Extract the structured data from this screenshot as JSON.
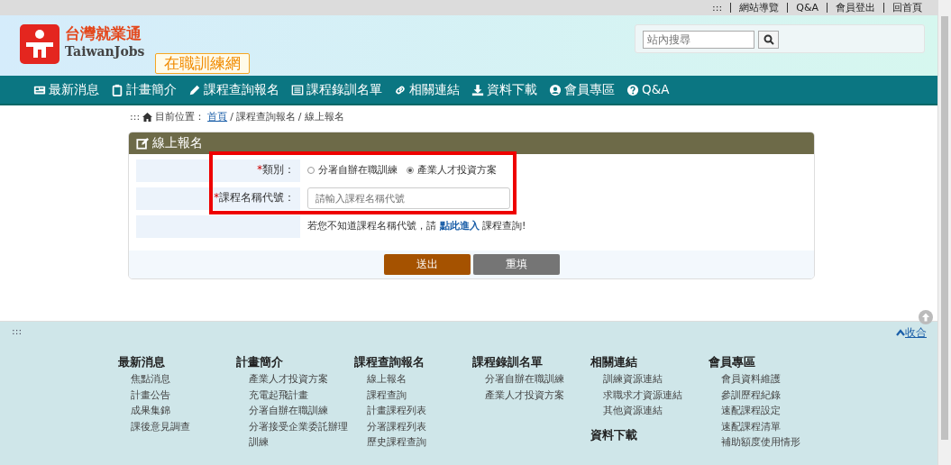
{
  "top_links": [
    ":::",
    "網站導覽",
    "Q&A",
    "會員登出",
    "回首頁"
  ],
  "logo": {
    "name": "台灣就業通",
    "subtitle": "TaiwanJobs"
  },
  "site_badge": "在職訓練網",
  "search": {
    "placeholder": "站內搜尋"
  },
  "nav": [
    {
      "label": "最新消息"
    },
    {
      "label": "計畫簡介"
    },
    {
      "label": "課程查詢報名"
    },
    {
      "label": "課程錄訓名單"
    },
    {
      "label": "相關連結"
    },
    {
      "label": "資料下載"
    },
    {
      "label": "會員專區"
    },
    {
      "label": "Q&A"
    }
  ],
  "breadcrumb": {
    "prefix": ":::",
    "label": "目前位置：",
    "separator": "/",
    "items": [
      {
        "text": "首頁",
        "link": true
      },
      {
        "text": "課程查詢報名",
        "link": false
      },
      {
        "text": "線上報名",
        "link": false
      }
    ]
  },
  "panel": {
    "title": "線上報名",
    "required_mark": "*",
    "category": {
      "label": "類別：",
      "options": [
        {
          "label": "分署自辦在職訓練",
          "selected": false
        },
        {
          "label": "產業人才投資方案",
          "selected": true
        }
      ]
    },
    "course": {
      "label": "課程名稱代號：",
      "placeholder": "請輸入課程名稱代號"
    },
    "hint": {
      "before": "若您不知道課程名稱代號，請",
      "link": "點此進入",
      "after": "課程查詢!"
    },
    "buttons": [
      {
        "label": "送出",
        "kind": "primary"
      },
      {
        "label": "重填",
        "kind": "secondary"
      }
    ]
  },
  "footer": {
    "prefix": ":::",
    "collapse": "收合",
    "columns": [
      {
        "sections": [
          {
            "heading": "最新消息",
            "items": [
              "焦點消息",
              "計畫公告",
              "成果集錦",
              "課後意見調查"
            ]
          }
        ]
      },
      {
        "sections": [
          {
            "heading": "計畫簡介",
            "items": [
              "產業人才投資方案",
              "充電起飛計畫",
              "分署自辦在職訓練",
              "分署接受企業委託辦理訓練"
            ]
          }
        ]
      },
      {
        "sections": [
          {
            "heading": "課程查詢報名",
            "items": [
              "線上報名",
              "課程查詢",
              "計畫課程列表",
              "分署課程列表",
              "歷史課程查詢"
            ]
          }
        ]
      },
      {
        "sections": [
          {
            "heading": "課程錄訓名單",
            "items": [
              "分署自辦在職訓練",
              "產業人才投資方案"
            ]
          }
        ]
      },
      {
        "sections": [
          {
            "heading": "相關連結",
            "items": [
              "訓練資源連結",
              "求職求才資源連結",
              "其他資源連結"
            ]
          },
          {
            "heading": "資料下載"
          }
        ]
      },
      {
        "sections": [
          {
            "heading": "會員專區",
            "items": [
              "會員資料維護",
              "參訓歷程紀錄",
              "速配課程設定",
              "速配課程清單",
              "補助額度使用情形"
            ]
          }
        ]
      }
    ]
  }
}
